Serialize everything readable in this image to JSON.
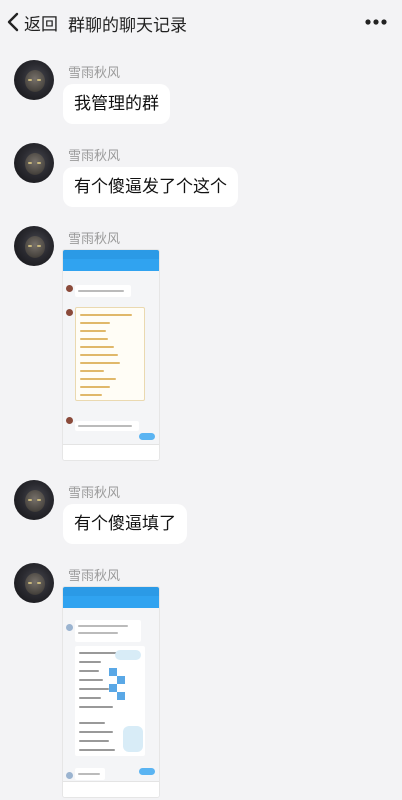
{
  "header": {
    "back_label": "返回",
    "title": "群聊的聊天记录"
  },
  "messages": [
    {
      "sender": "雪雨秋风",
      "text": "我管理的群"
    },
    {
      "sender": "雪雨秋风",
      "text": "有个傻逼发了个这个"
    },
    {
      "sender": "雪雨秋风",
      "type": "image"
    },
    {
      "sender": "雪雨秋风",
      "text": "有个傻逼填了"
    },
    {
      "sender": "雪雨秋风",
      "type": "image"
    }
  ],
  "icons": {
    "back": "chevron-left-icon",
    "more": "more-dots-icon"
  },
  "colors": {
    "background": "#f3f3f5",
    "bubble": "#ffffff",
    "sender_name": "#9a9a9a",
    "screenshot_header": "#30a3f0"
  }
}
